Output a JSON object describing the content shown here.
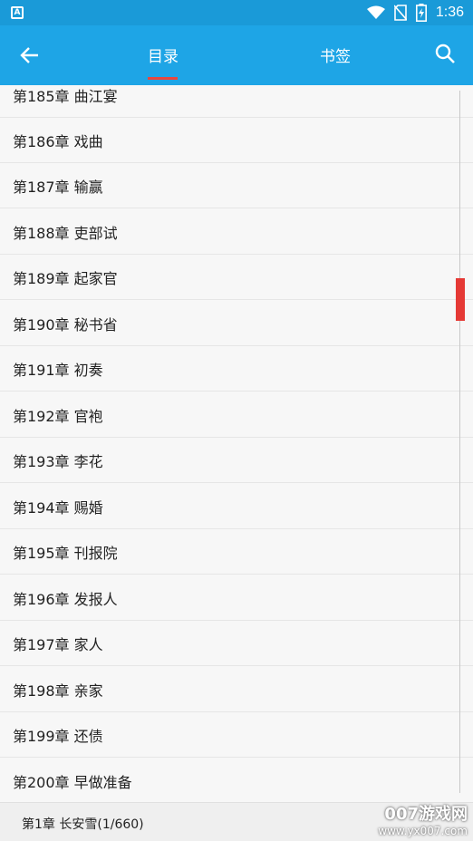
{
  "status_bar": {
    "app_icon_letter": "A",
    "time": "1:36"
  },
  "app_bar": {
    "tabs": [
      {
        "label": "目录",
        "selected": true
      },
      {
        "label": "书签",
        "selected": false
      }
    ],
    "accent_color": "#1ea5e6",
    "indicator_color": "#e8473d"
  },
  "chapters": [
    "第185章 曲江宴",
    "第186章 戏曲",
    "第187章 输赢",
    "第188章 吏部试",
    "第189章 起家官",
    "第190章 秘书省",
    "第191章 初奏",
    "第192章 官袍",
    "第193章 李花",
    "第194章 赐婚",
    "第195章 刊报院",
    "第196章 发报人",
    "第197章 家人",
    "第198章 亲家",
    "第199章 还债",
    "第200章 早做准备"
  ],
  "current_chapter": "第1章 长安雪(1/660)",
  "watermark": {
    "brand": "007游戏网",
    "url": "www.yx007.com"
  },
  "icons": {
    "back": "arrow-left-icon",
    "search": "search-icon"
  }
}
